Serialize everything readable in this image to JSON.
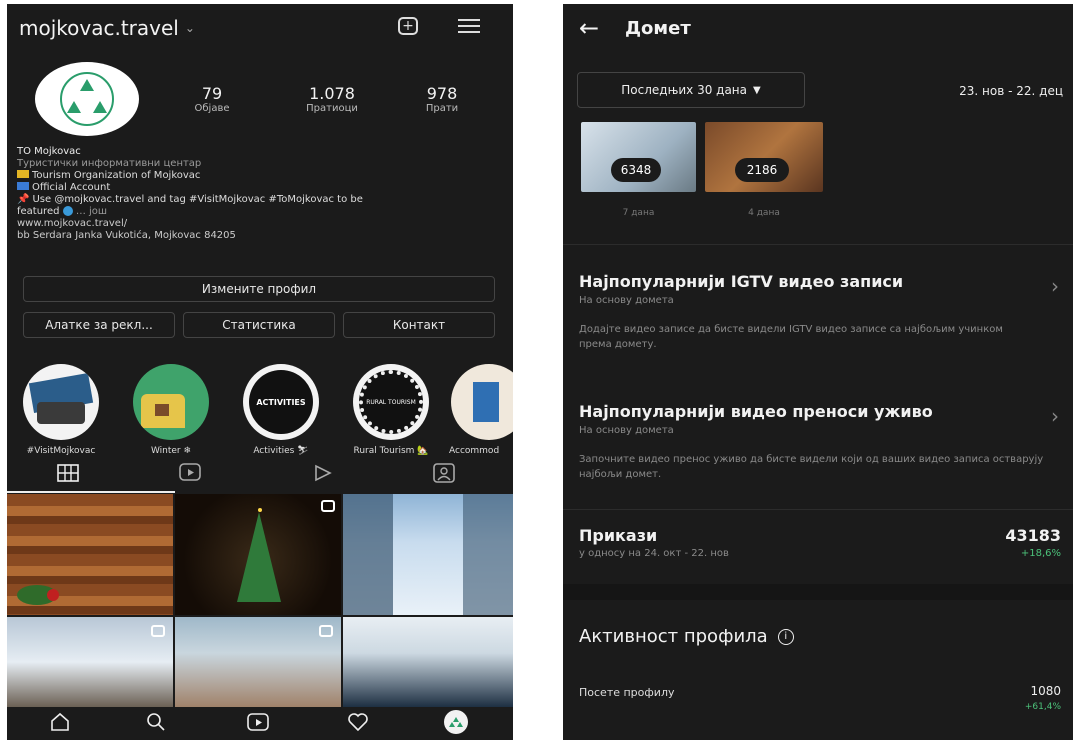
{
  "profile": {
    "username": "mojkovac.travel",
    "stats": [
      {
        "value": "79",
        "label": "Објаве"
      },
      {
        "value": "1.078",
        "label": "Пратиоци"
      },
      {
        "value": "978",
        "label": "Прати"
      }
    ],
    "name": "TO Mojkovac",
    "category": "Туристички информативни центар",
    "bio": [
      "Tourism Organization of Mojkovac",
      "Official Account",
      "Use @mojkovac.travel and tag #VisitMojkovac #ToMojkovac to be",
      "featured",
      "… још"
    ],
    "website": "www.mojkovac.travel/",
    "address": "bb Serdara Janka Vukotića, Mojkovac 84205",
    "buttons": {
      "edit": "Измените профил",
      "ads": "Алатке за рекл...",
      "stats": "Статистика",
      "contact": "Контакт"
    },
    "highlights": [
      {
        "caption": "#VisitMojkovac"
      },
      {
        "caption": "Winter ❄"
      },
      {
        "caption": "Activities ⛷",
        "badge": "ACTIVITIES"
      },
      {
        "caption": "Rural Tourism 🏡",
        "badge": "RURAL TOURISM"
      },
      {
        "caption": "Accommod"
      }
    ],
    "tabs": [
      "grid-icon",
      "reels-tab-icon",
      "video-tab-icon",
      "tagged-icon"
    ],
    "bottom_nav": [
      "home-icon",
      "search-icon",
      "reels-icon",
      "heart-icon",
      "profile-icon"
    ]
  },
  "insights": {
    "title": "Домет",
    "date_filter": "Последњих 30 дана",
    "date_range": "23. нов - 22. дец",
    "thumbnails": [
      {
        "count": "6348",
        "age": "7 дана"
      },
      {
        "count": "2186",
        "age": "4 дана"
      }
    ],
    "sections": [
      {
        "title": "Најпопуларнији IGTV видео записи",
        "subtitle": "На основу домета",
        "description": "Додајте видео записе да бисте видели IGTV видео записе са најбољим учинком према домету."
      },
      {
        "title": "Најпопуларнији видео преноси уживо",
        "subtitle": "На основу домета",
        "description": "Започните видео пренос уживо да бисте видели који од ваших видео записа остварују најбољи домет."
      }
    ],
    "impressions": {
      "label": "Прикази",
      "value": "43183",
      "compare": "у односу на 24. окт - 22. нов",
      "change": "+18,6%"
    },
    "activity": {
      "title": "Активност профила",
      "visits_label": "Посете профилу",
      "visits_value": "1080",
      "visits_change": "+61,4%"
    },
    "colors": {
      "positive": "#4cc27a",
      "background": "#1b1b1b"
    }
  }
}
